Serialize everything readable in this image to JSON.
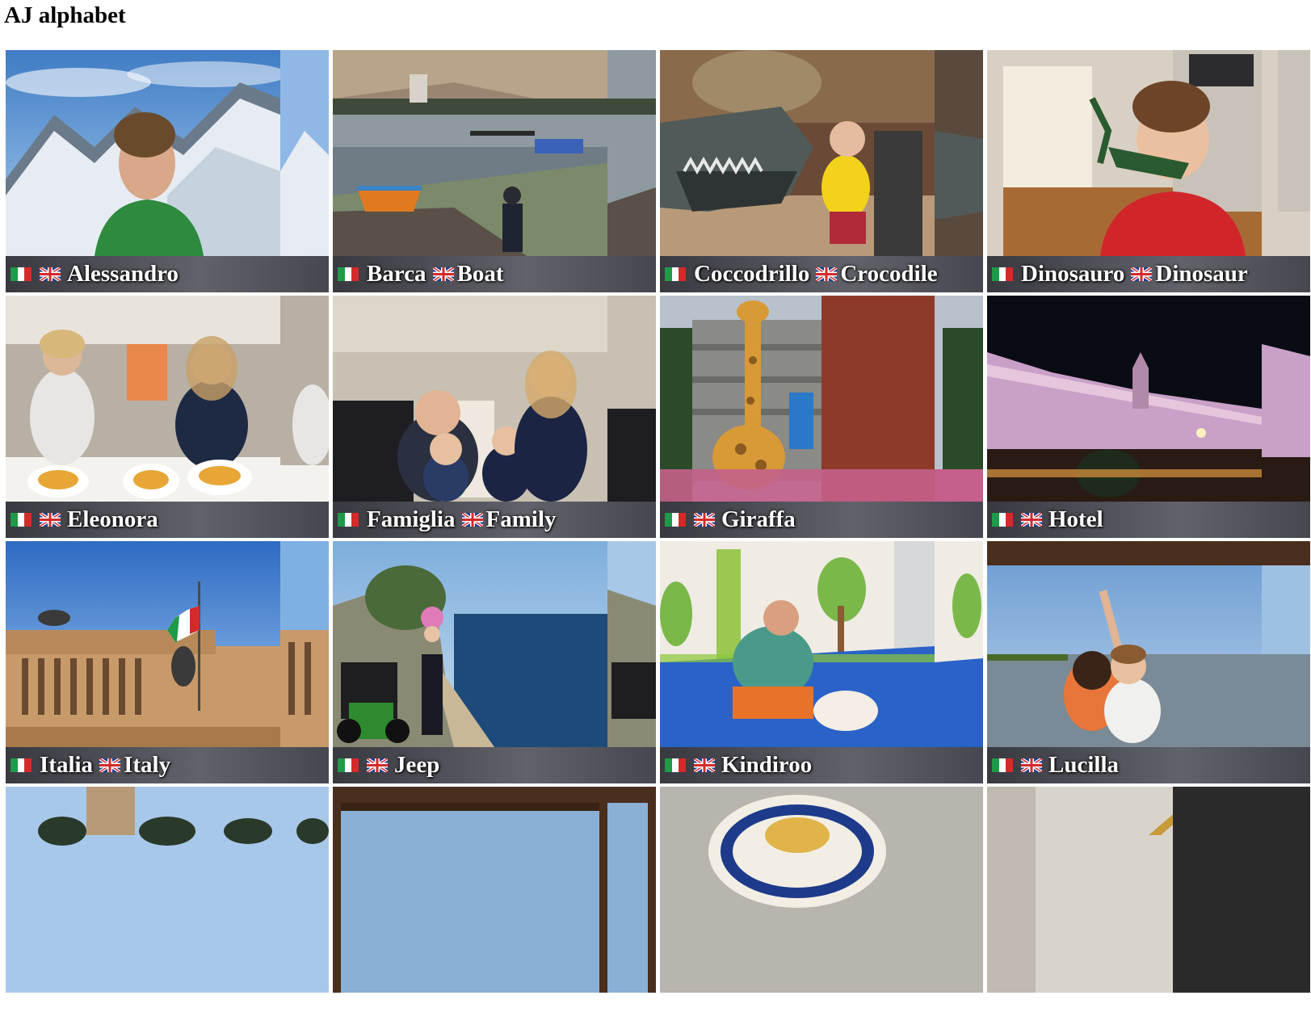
{
  "page": {
    "title": "AJ alphabet"
  },
  "tiles": [
    {
      "it": "Alessandro",
      "en": ""
    },
    {
      "it": "Barca",
      "en": "Boat"
    },
    {
      "it": "Coccodrillo",
      "en": "Crocodile"
    },
    {
      "it": "Dinosauro",
      "en": "Dinosaur"
    },
    {
      "it": "Eleonora",
      "en": ""
    },
    {
      "it": "Famiglia",
      "en": "Family"
    },
    {
      "it": "Giraffa",
      "en": ""
    },
    {
      "it": "Hotel",
      "en": ""
    },
    {
      "it": "Italia",
      "en": "Italy"
    },
    {
      "it": "Jeep",
      "en": ""
    },
    {
      "it": "Kindiroo",
      "en": ""
    },
    {
      "it": "Lucilla",
      "en": ""
    },
    {
      "it": "",
      "en": ""
    },
    {
      "it": "",
      "en": ""
    },
    {
      "it": "",
      "en": ""
    },
    {
      "it": "",
      "en": ""
    }
  ],
  "icons": {
    "italian": "italy-flag-icon",
    "english": "uk-flag-icon"
  },
  "colors": {
    "caption_text": "#ffffff",
    "background": "#ffffff",
    "title_text": "#000000"
  }
}
